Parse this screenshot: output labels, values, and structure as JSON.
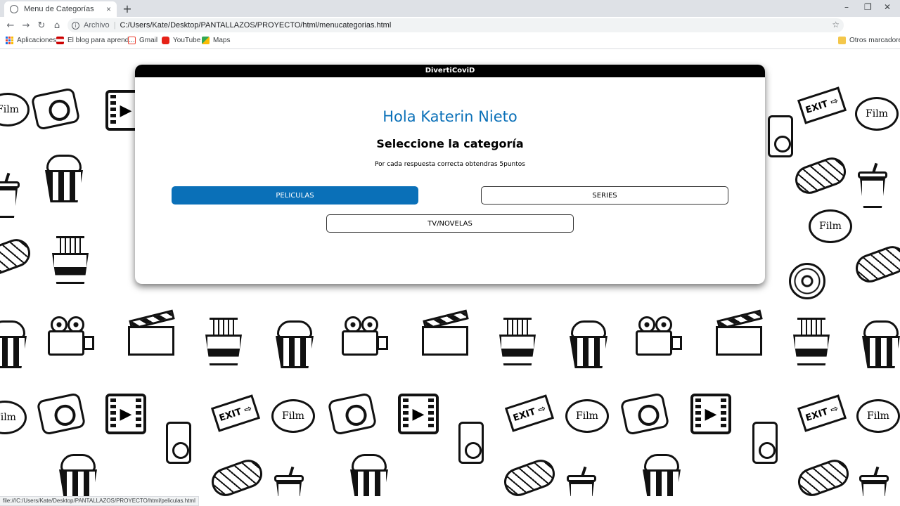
{
  "browser": {
    "tab_title": "Menu de Categorías",
    "new_tab": "+",
    "close_tab": "×",
    "window_controls": [
      "–",
      "❐",
      "✕"
    ],
    "scheme_label": "Archivo",
    "url": "C:/Users/Kate/Desktop/PANTALLAZOS/PROYECTO/html/menucategorias.html",
    "bookmarks": [
      "Aplicaciones",
      "El blog para aprend...",
      "Gmail",
      "YouTube",
      "Maps"
    ],
    "other_bookmarks": "Otros marcadores",
    "status_url": "file:///C:/Users/Kate/Desktop/PANTALLAZOS/PROYECTO/html/peliculas.html"
  },
  "background_doodles": {
    "exit_text": "EXIT ⇨",
    "bubble_text": "Film"
  },
  "modal": {
    "header": "DivertiCoviD",
    "greeting": "Hola Katerin Nieto",
    "subtitle": "Seleccione la categoría",
    "note": "Por cada respuesta correcta obtendras 5puntos",
    "buttons": {
      "peliculas": "PELICULAS",
      "series": "SERIES",
      "tv_novelas": "TV/NOVELAS"
    }
  },
  "colors": {
    "accent": "#0a70b8",
    "header": "#000000"
  }
}
